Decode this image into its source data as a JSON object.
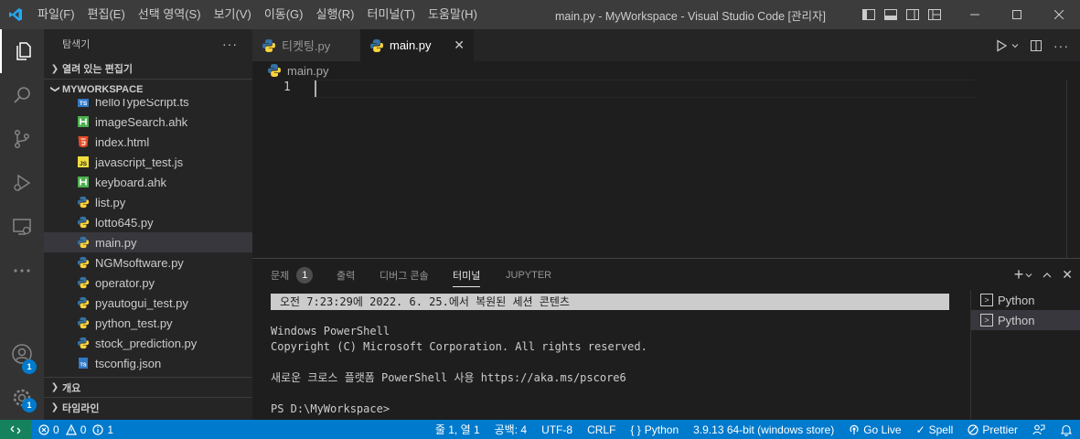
{
  "titlebar": {
    "menus": [
      "파일(F)",
      "편집(E)",
      "선택 영역(S)",
      "보기(V)",
      "이동(G)",
      "실행(R)",
      "터미널(T)",
      "도움말(H)"
    ],
    "title": "main.py - MyWorkspace - Visual Studio Code [관리자]"
  },
  "activitybar": {
    "items": [
      "explorer-icon",
      "search-icon",
      "source-control-icon",
      "run-debug-icon",
      "remote-explorer-icon",
      "more-icon"
    ],
    "accounts_badge": "1",
    "settings_badge": "1"
  },
  "sidebar": {
    "title": "탐색기",
    "open_editors_label": "열려 있는 편집기",
    "workspace_label": "MYWORKSPACE",
    "files": [
      {
        "name": "helloTypeScript.ts",
        "icon": "ts"
      },
      {
        "name": "imageSearch.ahk",
        "icon": "ahk"
      },
      {
        "name": "index.html",
        "icon": "html"
      },
      {
        "name": "javascript_test.js",
        "icon": "js"
      },
      {
        "name": "keyboard.ahk",
        "icon": "ahk"
      },
      {
        "name": "list.py",
        "icon": "py"
      },
      {
        "name": "lotto645.py",
        "icon": "py"
      },
      {
        "name": "main.py",
        "icon": "py",
        "selected": true
      },
      {
        "name": "NGMsoftware.py",
        "icon": "py"
      },
      {
        "name": "operator.py",
        "icon": "py"
      },
      {
        "name": "pyautogui_test.py",
        "icon": "py"
      },
      {
        "name": "python_test.py",
        "icon": "py"
      },
      {
        "name": "stock_prediction.py",
        "icon": "py"
      },
      {
        "name": "tsconfig.json",
        "icon": "tsconfig"
      }
    ],
    "outline_label": "개요",
    "timeline_label": "타임라인"
  },
  "tabs": [
    {
      "label": "티켓팅.py",
      "active": false
    },
    {
      "label": "main.py",
      "active": true
    }
  ],
  "breadcrumb": "main.py",
  "editor": {
    "line_number": "1"
  },
  "panel": {
    "tabs": [
      "문제",
      "출력",
      "디버그 콘솔",
      "터미널",
      "JUPYTER"
    ],
    "problems_count": "1",
    "terminal_lines": {
      "restored": "오전 7:23:29에 2022. 6. 25.에서 복원된 세션 콘텐츠",
      "line1": "Windows PowerShell",
      "line2": "Copyright (C) Microsoft Corporation. All rights reserved.",
      "line3": "새로운 크로스 플랫폼 PowerShell 사용 https://aka.ms/pscore6",
      "line4": "PS D:\\MyWorkspace>"
    },
    "terminals": [
      "Python",
      "Python"
    ]
  },
  "statusbar": {
    "errors": "0",
    "warnings": "0",
    "info": "1",
    "position": "줄 1, 열 1",
    "spaces": "공백: 4",
    "encoding": "UTF-8",
    "eol": "CRLF",
    "language": "Python",
    "interpreter": "3.9.13 64-bit (windows store)",
    "golive": "Go Live",
    "spell": "Spell",
    "prettier": "Prettier"
  },
  "colors": {
    "accent": "#007acc",
    "remote": "#16825d",
    "python_blue": "#3572a5",
    "python_yellow": "#ffd43b"
  }
}
